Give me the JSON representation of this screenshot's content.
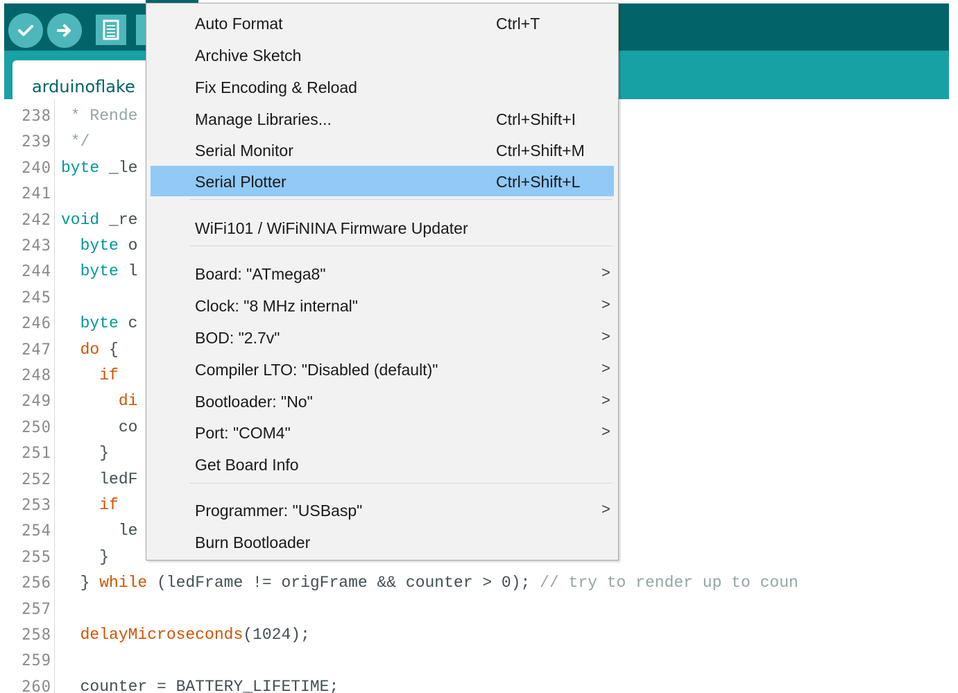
{
  "window": {
    "tab_name": "arduinoflake"
  },
  "toolbar": {
    "buttons": [
      {
        "name": "verify",
        "icon": "check-icon"
      },
      {
        "name": "upload",
        "icon": "arrow-right-icon"
      },
      {
        "name": "new",
        "icon": "file-icon"
      },
      {
        "name": "open",
        "icon": "open-icon"
      }
    ]
  },
  "editor": {
    "lines": [
      {
        "n": "238",
        "parts": [
          {
            "t": " * Rende",
            "c": "cm"
          }
        ]
      },
      {
        "n": "239",
        "parts": [
          {
            "t": " */",
            "c": "cm"
          }
        ]
      },
      {
        "n": "240",
        "parts": [
          {
            "t": "byte",
            "c": "kw"
          },
          {
            "t": " _le",
            "c": "tx"
          }
        ]
      },
      {
        "n": "241",
        "parts": []
      },
      {
        "n": "242",
        "parts": [
          {
            "t": "void",
            "c": "kw"
          },
          {
            "t": " _re",
            "c": "tx"
          }
        ]
      },
      {
        "n": "243",
        "parts": [
          {
            "t": "  byte",
            "c": "kw"
          },
          {
            "t": " o",
            "c": "tx"
          }
        ]
      },
      {
        "n": "244",
        "parts": [
          {
            "t": "  byte",
            "c": "kw"
          },
          {
            "t": " l",
            "c": "tx"
          }
        ]
      },
      {
        "n": "245",
        "parts": []
      },
      {
        "n": "246",
        "parts": [
          {
            "t": "  byte",
            "c": "kw"
          },
          {
            "t": " c",
            "c": "tx"
          }
        ]
      },
      {
        "n": "247",
        "parts": [
          {
            "t": "  do",
            "c": "kw2"
          },
          {
            "t": " {",
            "c": "tx"
          }
        ]
      },
      {
        "n": "248",
        "parts": [
          {
            "t": "    if",
            "c": "kw2"
          }
        ]
      },
      {
        "n": "249",
        "parts": [
          {
            "t": "      di",
            "c": "kw2"
          }
        ]
      },
      {
        "n": "250",
        "parts": [
          {
            "t": "      co",
            "c": "tx"
          }
        ]
      },
      {
        "n": "251",
        "parts": [
          {
            "t": "    }",
            "c": "tx"
          }
        ]
      },
      {
        "n": "252",
        "parts": [
          {
            "t": "    ledF",
            "c": "tx"
          }
        ]
      },
      {
        "n": "253",
        "parts": [
          {
            "t": "    if",
            "c": "kw2"
          }
        ]
      },
      {
        "n": "254",
        "parts": [
          {
            "t": "      le",
            "c": "tx"
          }
        ]
      },
      {
        "n": "255",
        "parts": [
          {
            "t": "    }",
            "c": "tx"
          }
        ]
      },
      {
        "n": "256",
        "parts": [
          {
            "t": "  } ",
            "c": "tx"
          },
          {
            "t": "while",
            "c": "kw2"
          },
          {
            "t": " (ledFrame != origFrame && counter > 0); ",
            "c": "tx"
          },
          {
            "t": "// try to render up to coun",
            "c": "cm"
          }
        ]
      },
      {
        "n": "257",
        "parts": []
      },
      {
        "n": "258",
        "parts": [
          {
            "t": "  delayMicroseconds",
            "c": "kw2"
          },
          {
            "t": "(1024);",
            "c": "tx"
          }
        ]
      },
      {
        "n": "259",
        "parts": []
      },
      {
        "n": "260",
        "parts": [
          {
            "t": "  counter = BATTERY_LIFETIME;",
            "c": "tx"
          }
        ]
      }
    ]
  },
  "menu": {
    "items": [
      {
        "label": "Auto Format",
        "shortcut": "Ctrl+T"
      },
      {
        "label": "Archive Sketch",
        "shortcut": ""
      },
      {
        "label": "Fix Encoding & Reload",
        "shortcut": ""
      },
      {
        "label": "Manage Libraries...",
        "shortcut": "Ctrl+Shift+I"
      },
      {
        "label": "Serial Monitor",
        "shortcut": "Ctrl+Shift+M"
      },
      {
        "label": "Serial Plotter",
        "shortcut": "Ctrl+Shift+L",
        "highlighted": true
      },
      {
        "label": "WiFi101 / WiFiNINA Firmware Updater",
        "shortcut": ""
      },
      {
        "label": "Board: \"ATmega8\"",
        "submenu": true
      },
      {
        "label": "Clock: \"8 MHz internal\"",
        "submenu": true
      },
      {
        "label": "BOD: \"2.7v\"",
        "submenu": true
      },
      {
        "label": "Compiler LTO: \"Disabled (default)\"",
        "submenu": true
      },
      {
        "label": "Bootloader: \"No\"",
        "submenu": true
      },
      {
        "label": "Port: \"COM4\"",
        "submenu": true
      },
      {
        "label": "Get Board Info",
        "shortcut": ""
      },
      {
        "label": "Programmer: \"USBasp\"",
        "submenu": true
      },
      {
        "label": "Burn Bootloader",
        "shortcut": ""
      }
    ],
    "submenu_arrow": ">",
    "highlight_color": "#91c9f7"
  },
  "colors": {
    "toolbar": "#006468",
    "tabbar": "#17a1a5",
    "button": "#4db7bb"
  }
}
